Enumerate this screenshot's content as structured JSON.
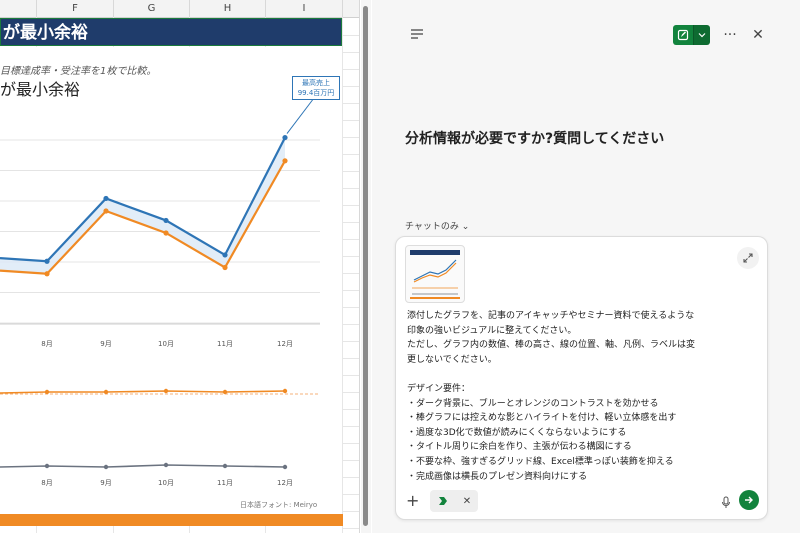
{
  "sheet": {
    "columns": [
      "F",
      "G",
      "H",
      "I"
    ],
    "title_band": "が最小余裕",
    "subtitle": "目標達成率・受注率を1枚で比較。",
    "chart_title": "が最小余裕",
    "callout_line1": "最高売上",
    "callout_line2": "99.4百万円",
    "footer_note": "日本語フォント: Meiryo",
    "colors": {
      "title_band": "#1f3c6b",
      "blue": "#2e75b6",
      "orange": "#f08a24",
      "gray": "#6b7380"
    }
  },
  "chart_data": {
    "type": "line",
    "categories": [
      "8月",
      "9月",
      "10月",
      "11月",
      "12月"
    ],
    "series": [
      {
        "name": "",
        "color": "#2e75b6",
        "values": [
          60,
          80,
          73,
          62,
          99.4
        ]
      },
      {
        "name": "",
        "color": "#f08a24",
        "values": [
          56,
          76,
          69,
          58,
          92
        ]
      }
    ],
    "ylim": [
      40,
      105
    ],
    "lower_series": [
      {
        "name": "",
        "color": "#f08a24",
        "values": [
          90,
          90,
          91,
          90,
          91
        ]
      },
      {
        "name": "",
        "color": "#6b7380",
        "values": [
          77,
          76,
          78,
          77,
          76
        ]
      }
    ],
    "title": "が最小余裕",
    "grid": true
  },
  "pane": {
    "icons": {
      "menu": "menu-icon",
      "new_chat": "new-chat-icon",
      "chevron": "chevron-down-icon",
      "more": "more-icon",
      "close": "close-icon",
      "expand": "expand-icon",
      "plus": "plus-icon",
      "mic": "mic-icon",
      "send": "send-arrow-icon"
    },
    "more_label": "···",
    "close_label": "✕",
    "heading": "分析情報が必要ですか?質問してください",
    "mode_label": "チャットのみ ⌄",
    "prompt_text": "添付したグラフを、記事のアイキャッチやセミナー資料で使えるような\n印象の強いビジュアルに整えてください。\nただし、グラフ内の数値、棒の高さ、線の位置、軸、凡例、ラベルは変\n更しないでください。\n\nデザイン要件：\n・ダーク背景に、ブルーとオレンジのコントラストを効かせる\n・棒グラフには控えめな影とハイライトを付け、軽い立体感を出す\n・過度な3D化で数値が読みにくくならないようにする\n・タイトル周りに余白を作り、主張が伝わる構図にする\n・不要な枠、強すぎるグリッド線、Excel標準っぽい装飾を抑える\n・完成画像は横長のプレゼン資料向けにする",
    "plus_label": "+",
    "chip_close": "✕",
    "accent": "#12833d"
  }
}
